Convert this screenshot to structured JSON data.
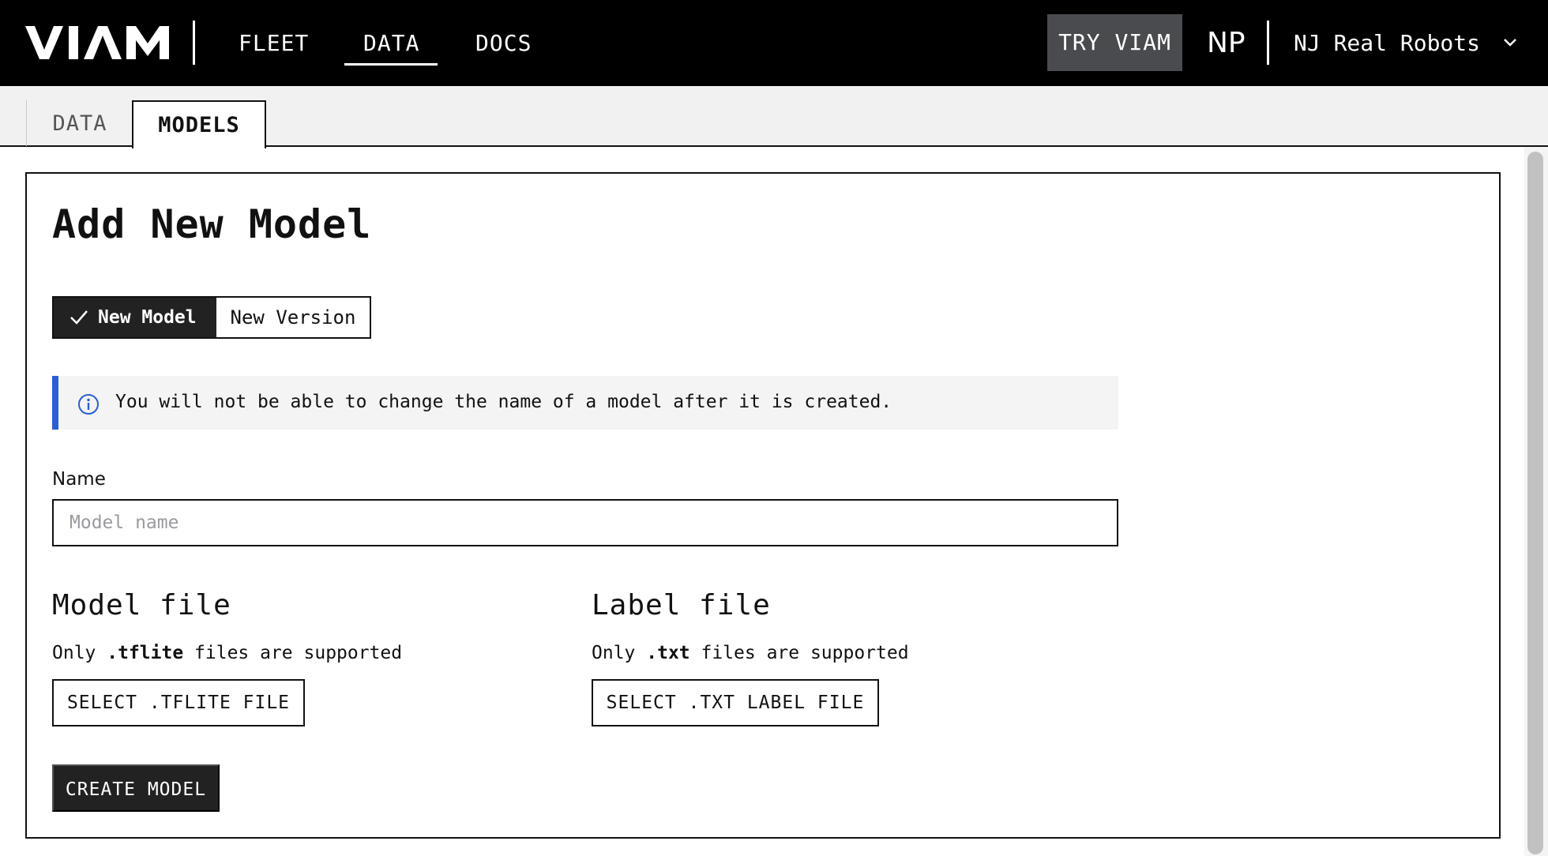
{
  "header": {
    "logo_icon": "viam-logo",
    "nav": [
      {
        "label": "FLEET",
        "active": false
      },
      {
        "label": "DATA",
        "active": true
      },
      {
        "label": "DOCS",
        "active": false
      }
    ],
    "try_label": "TRY VIAM",
    "org_initials": "NP",
    "org_name": "NJ Real Robots",
    "org_dropdown_icon": "chevron-down-icon"
  },
  "tabs": [
    {
      "label": "DATA",
      "active": false
    },
    {
      "label": "MODELS",
      "active": true
    }
  ],
  "form": {
    "title": "Add New Model",
    "mode_toggle": {
      "new_model_label": "New Model",
      "new_version_label": "New Version",
      "selected": "New Model",
      "selected_icon": "checkmark-icon"
    },
    "notice": {
      "icon": "info-icon",
      "text": "You will not be able to change the name of a model after it is created.",
      "accent_color": "#2a5fd1"
    },
    "name_field": {
      "label": "Name",
      "placeholder": "Model name",
      "value": ""
    },
    "model_file": {
      "title": "Model file",
      "help_prefix": "Only ",
      "help_ext": ".tflite",
      "help_suffix": " files are supported",
      "button_label": "SELECT .TFLITE FILE"
    },
    "label_file": {
      "title": "Label file",
      "help_prefix": "Only ",
      "help_ext": ".txt",
      "help_suffix": " files are supported",
      "button_label": "SELECT .TXT LABEL FILE"
    },
    "submit_label": "CREATE MODEL"
  }
}
